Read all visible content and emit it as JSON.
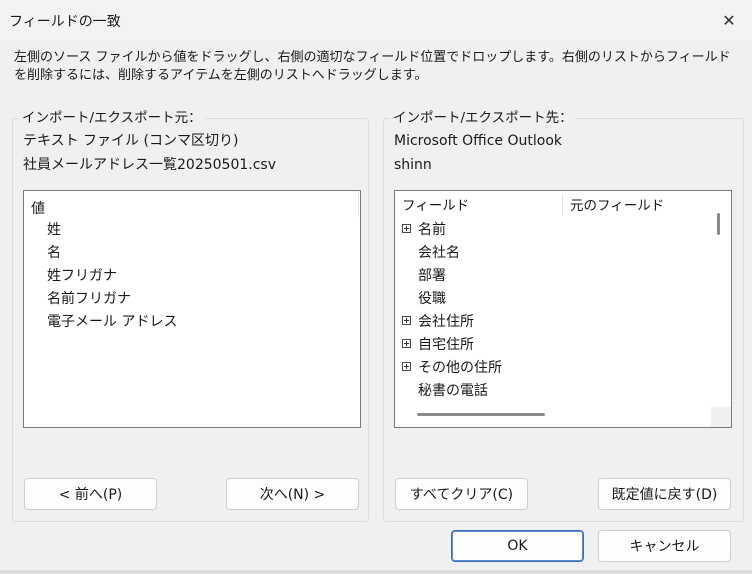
{
  "window": {
    "title": "フィールドの一致",
    "close_glyph": "✕"
  },
  "description": "左側のソース ファイルから値をドラッグし、右側の適切なフィールド位置でドロップします。右側のリストからフィールドを削除するには、削除するアイテムを左側のリストへドラッグします。",
  "source": {
    "legend": "インポート/エクスポート元：",
    "type": "テキスト ファイル (コンマ区切り)",
    "file": "社員メールアドレス一覧20250501.csv",
    "list_header": "値",
    "items": [
      "姓",
      "名",
      "姓フリガナ",
      "名前フリガナ",
      "電子メール アドレス"
    ]
  },
  "destination": {
    "legend": "インポート/エクスポート先：",
    "app": "Microsoft Office Outlook",
    "profile": "shinn",
    "columns": [
      "フィールド",
      "元のフィールド"
    ],
    "fields": [
      {
        "name": "名前",
        "expandable": true
      },
      {
        "name": "会社名",
        "expandable": false
      },
      {
        "name": "部署",
        "expandable": false
      },
      {
        "name": "役職",
        "expandable": false
      },
      {
        "name": "会社住所",
        "expandable": true
      },
      {
        "name": "自宅住所",
        "expandable": true
      },
      {
        "name": "その他の住所",
        "expandable": true
      },
      {
        "name": "秘書の電話",
        "expandable": false
      }
    ]
  },
  "buttons": {
    "prev": "< 前へ(P)",
    "next": "次へ(N) >",
    "clear_all": "すべてクリア(C)",
    "default": "既定値に戻す(D)",
    "ok": "OK",
    "cancel": "キャンセル"
  }
}
